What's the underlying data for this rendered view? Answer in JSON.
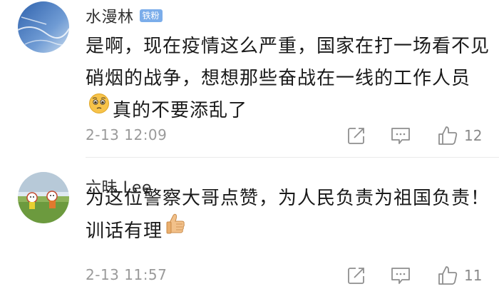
{
  "comments": [
    {
      "username": "水漫林",
      "badge": "铁粉",
      "text_before_emoji": "是啊，现在疫情这么严重，国家在打一场看不见硝烟的战争，想想那些奋战在一线的工作人员",
      "emoji": "pleading-face-icon",
      "text_after_emoji": "真的不要添乱了",
      "timestamp": "2-13 12:09",
      "likes": "12",
      "avatar_colors": [
        "#3a6fb5",
        "#b6cde6"
      ]
    },
    {
      "username": "六昧 Lee",
      "text_before_emoji": "为这位警察大哥点赞，为人民负责为祖国负责！训话有理",
      "emoji": "thumbs-up-icon",
      "timestamp": "2-13 11:57",
      "likes": "11",
      "avatar_colors": [
        "#6a9a3a",
        "#d8e6f2"
      ]
    }
  ],
  "colors": {
    "badge": "#7badea",
    "meta_text": "#9a9a9a",
    "icon": "#9a9a9a"
  }
}
